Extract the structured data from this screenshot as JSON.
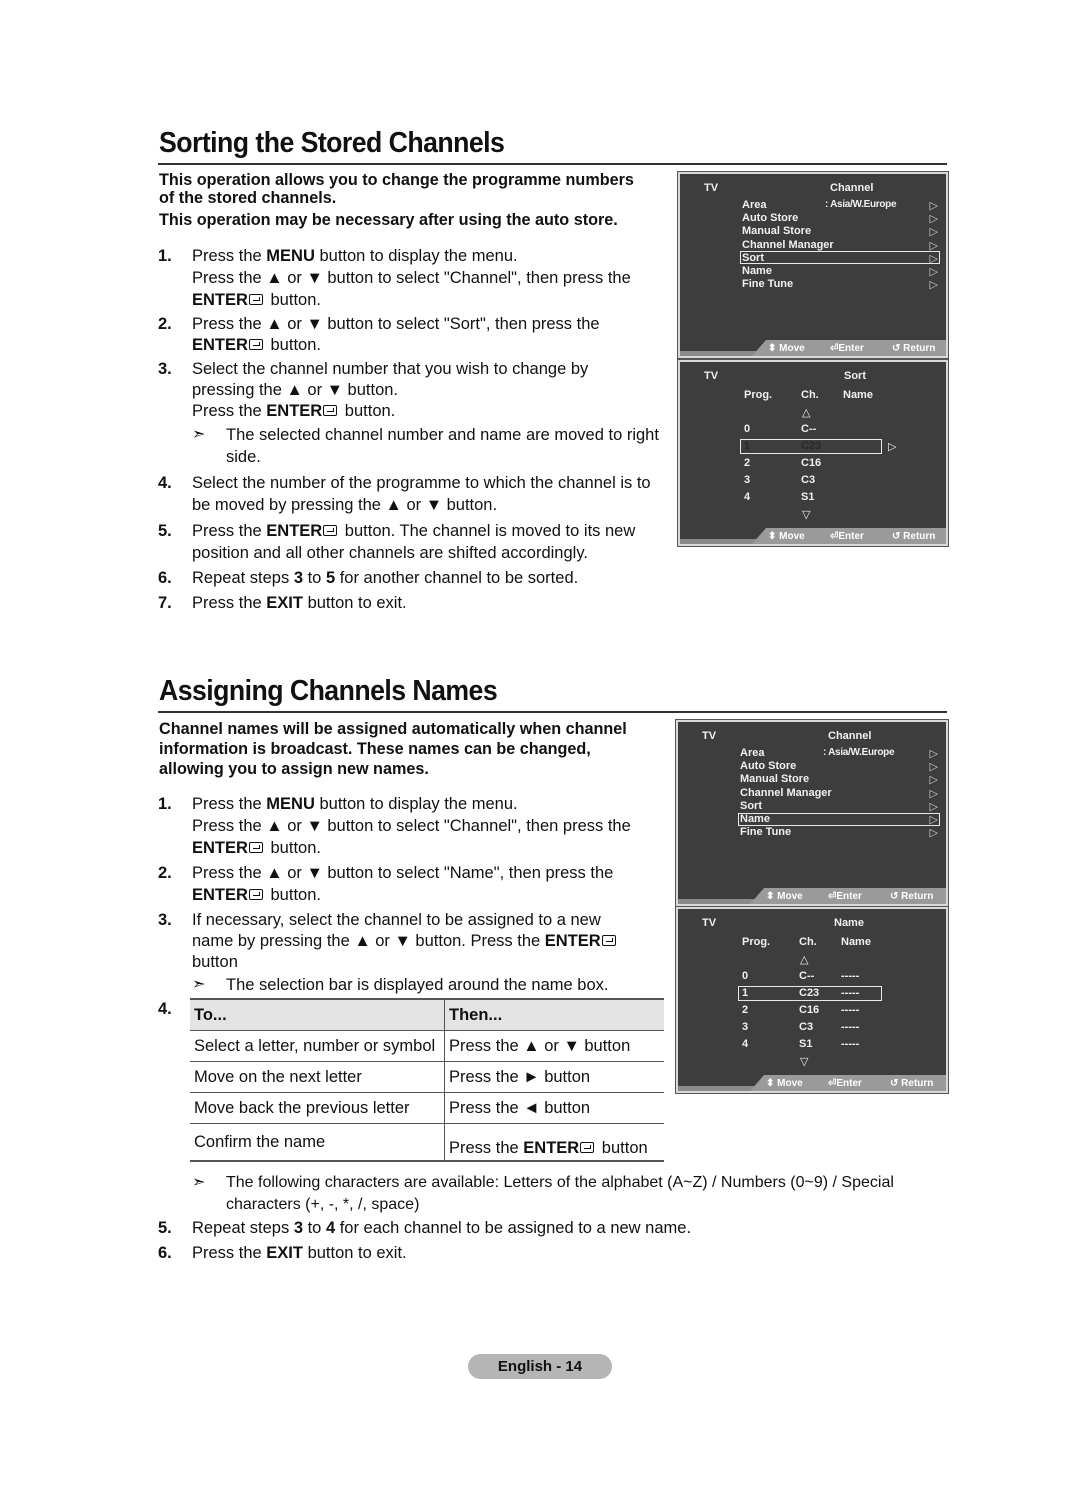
{
  "section1": {
    "title": "Sorting the Stored Channels",
    "intro": [
      "This operation allows you to change the programme numbers",
      "of the stored channels.",
      "This operation may be necessary after using the auto store."
    ],
    "steps": [
      {
        "num": "1.",
        "lines": [
          "Press the |MENU| button to display the menu.",
          "Press the ▲ or ▼ button to select \"Channel\", then press the",
          "|ENTER|@ button."
        ]
      },
      {
        "num": "2.",
        "lines": [
          "Press the ▲ or ▼ button to select \"Sort\", then press the",
          "|ENTER|@ button."
        ]
      },
      {
        "num": "3.",
        "lines": [
          "Select the channel number that you wish to change by",
          "pressing the ▲ or ▼ button.",
          "Press the |ENTER|@ button."
        ]
      },
      {
        "num": "4.",
        "lines": [
          "Select the number of the programme to which the channel is to",
          "be moved by pressing the ▲ or ▼ button."
        ]
      },
      {
        "num": "5.",
        "lines": [
          "Press the |ENTER|@ button. The channel is moved to its new",
          "position and all other channels are shifted accordingly."
        ]
      },
      {
        "num": "6.",
        "lines": [
          "Repeat steps |3| to |5| for another channel to be sorted."
        ]
      },
      {
        "num": "7.",
        "lines": [
          "Press the |EXIT| button to exit."
        ]
      }
    ],
    "note": [
      "The selected channel number and name are moved to right",
      "side."
    ]
  },
  "section2": {
    "title": "Assigning Channels Names",
    "intro": [
      "Channel names will be assigned automatically when channel",
      "information is broadcast. These names can be changed,",
      "allowing you to assign new names."
    ],
    "steps": [
      {
        "num": "1.",
        "lines": [
          "Press the |MENU| button to display the menu.",
          "Press the ▲ or ▼ button to select \"Channel\", then press the",
          "|ENTER|@ button."
        ]
      },
      {
        "num": "2.",
        "lines": [
          "Press the ▲ or ▼ button to select \"Name\", then press the",
          "|ENTER|@ button."
        ]
      },
      {
        "num": "3.",
        "lines": [
          "If necessary, select the channel to be assigned to a new",
          "name by pressing the ▲ or ▼ button. Press the |ENTER|@",
          "button"
        ]
      },
      {
        "num": "4.",
        "lines": []
      },
      {
        "num": "5.",
        "lines": [
          "Repeat steps |3| to |4| for each channel to be assigned to a new name."
        ]
      },
      {
        "num": "6.",
        "lines": [
          "Press the |EXIT| button to exit."
        ]
      }
    ],
    "note1": [
      "The selection bar is displayed around the name box."
    ],
    "note2": [
      "The following characters are available: Letters of the alphabet (A~Z) / Numbers (0~9) / Special",
      "characters (+, -, *, /, space)"
    ],
    "table": {
      "headers": [
        "To...",
        "Then..."
      ],
      "rows": [
        [
          "Select a letter, number or symbol",
          "Press the ▲ or ▼ button"
        ],
        [
          "Move on the next letter",
          "Press the ► button"
        ],
        [
          "Move back the previous letter",
          "Press the ◄ button"
        ],
        [
          "Confirm the name",
          "Press the |ENTER|@ button"
        ]
      ]
    }
  },
  "osd_channel_menu": {
    "source": "TV",
    "title": "Channel",
    "items": [
      "Area",
      "Auto Store",
      "Manual Store",
      "Channel Manager",
      "Sort",
      "Name",
      "Fine Tune"
    ],
    "area_value": ": Asia/W.Europe",
    "arrow": "▷"
  },
  "osd_screens": {
    "screen1_selected": "Sort",
    "screen3_selected": "Name"
  },
  "osd_sort": {
    "source": "TV",
    "title": "Sort",
    "headers": [
      "Prog.",
      "Ch.",
      "Name"
    ],
    "up": "△",
    "down": "▽",
    "rows": [
      [
        "0",
        "C--"
      ],
      [
        "1",
        "C23"
      ],
      [
        "2",
        "C16"
      ],
      [
        "3",
        "C3"
      ],
      [
        "4",
        "S1"
      ]
    ],
    "selected_row": 1,
    "arrow": "▷"
  },
  "osd_name": {
    "source": "TV",
    "title": "Name",
    "headers": [
      "Prog.",
      "Ch.",
      "Name"
    ],
    "up": "△",
    "down": "▽",
    "rows": [
      [
        "0",
        "C--",
        "-----"
      ],
      [
        "1",
        "C23",
        "-----"
      ],
      [
        "2",
        "C16",
        "-----"
      ],
      [
        "3",
        "C3",
        "-----"
      ],
      [
        "4",
        "S1",
        "-----"
      ]
    ],
    "selected_row": 1
  },
  "osd_footer": {
    "move": "Move",
    "enter": "Enter",
    "return": "Return",
    "move_icon": "⬍",
    "return_icon": "↺"
  },
  "page_badge": "English - 14"
}
